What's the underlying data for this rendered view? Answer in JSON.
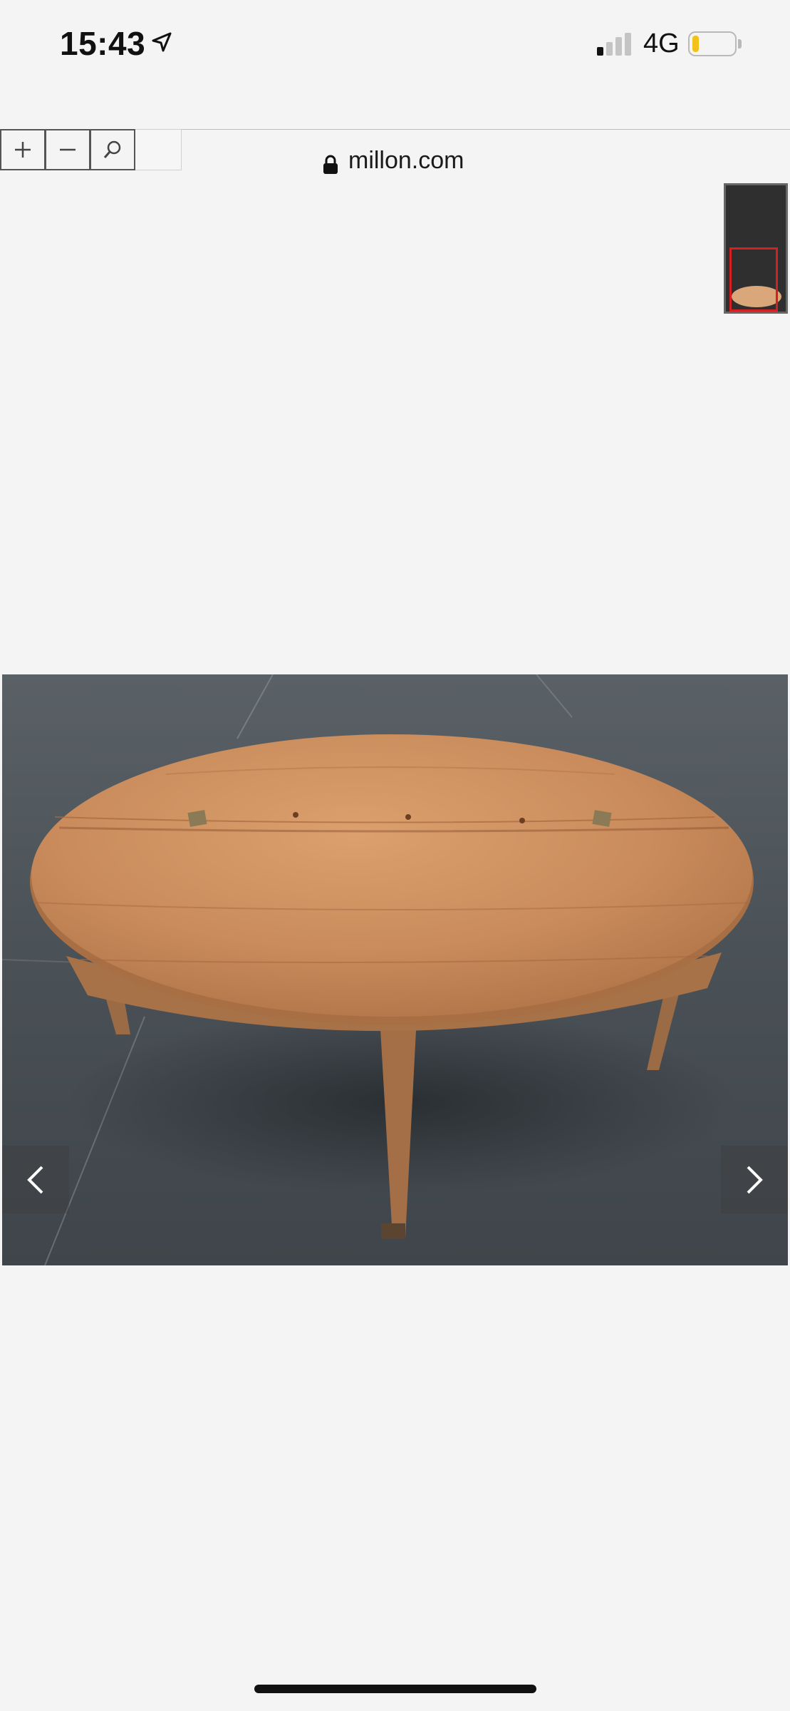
{
  "status_bar": {
    "time": "15:43",
    "network": "4G",
    "signal_bars_active": 1,
    "signal_bars_total": 4,
    "battery_level": 0.15,
    "battery_color": "#f1c21b"
  },
  "browser": {
    "url": "millon.com",
    "secure": true
  },
  "viewer": {
    "zoom_in_icon": "plus-icon",
    "zoom_out_icon": "minus-icon",
    "search_icon": "magnifier-icon",
    "navigator_viewport_color": "#d42020",
    "prev_icon": "chevron-left-icon",
    "next_icon": "chevron-right-icon"
  },
  "colors": {
    "background": "#f4f4f4",
    "floor": "#4c5257",
    "table_wood": "#c88a5c"
  }
}
